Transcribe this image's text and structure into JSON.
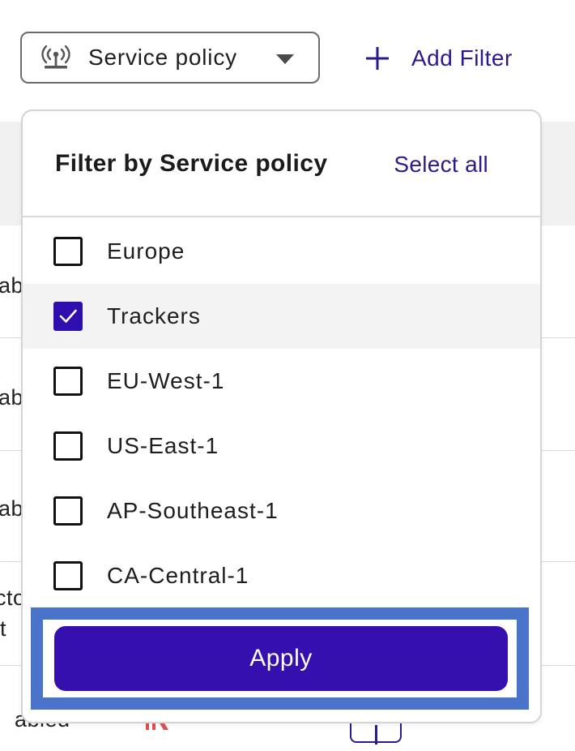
{
  "toolbar": {
    "policy_select_label": "Service policy",
    "add_filter_label": "Add Filter"
  },
  "dropdown": {
    "title": "Filter by Service policy",
    "select_all_label": "Select all",
    "items": [
      {
        "label": "Europe",
        "checked": false
      },
      {
        "label": "Trackers",
        "checked": true
      },
      {
        "label": "EU-West-1",
        "checked": false
      },
      {
        "label": "US-East-1",
        "checked": false
      },
      {
        "label": "AP-Southeast-1",
        "checked": false
      },
      {
        "label": "CA-Central-1",
        "checked": false
      }
    ],
    "apply_label": "Apply"
  },
  "background_table": {
    "row_fragments": [
      "ab",
      "ab",
      "ab",
      "cto",
      "t",
      "abled"
    ]
  },
  "colors": {
    "accent": "#2b1a8f",
    "apply_button": "#3510ae",
    "checkbox_checked": "#2e0fae",
    "highlight_frame": "#4a74c9"
  }
}
